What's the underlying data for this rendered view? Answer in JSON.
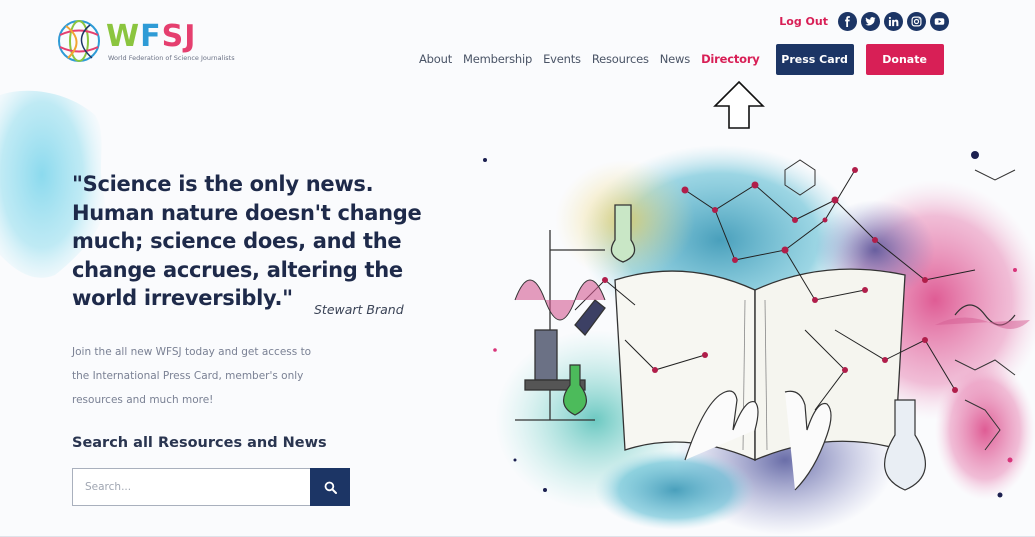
{
  "brand": {
    "letters": [
      "W",
      "F",
      "S",
      "J"
    ],
    "subtitle": "World Federation of Science Journalists",
    "colors": {
      "green": "#8bc53f",
      "blue": "#2e9bd6",
      "pink": "#e53f6f",
      "navy": "#1c3565",
      "accent": "#d81f56"
    }
  },
  "topbar": {
    "logout_label": "Log Out",
    "social_icons": [
      "facebook-icon",
      "twitter-icon",
      "linkedin-icon",
      "instagram-icon",
      "youtube-icon"
    ]
  },
  "nav": {
    "items": [
      {
        "label": "About"
      },
      {
        "label": "Membership"
      },
      {
        "label": "Events"
      },
      {
        "label": "Resources"
      },
      {
        "label": "News"
      },
      {
        "label": "Directory"
      }
    ],
    "active": "Directory",
    "press_card_label": "Press Card",
    "donate_label": "Donate"
  },
  "hero": {
    "quote_lines": [
      "\"Science is the only news.",
      "Human nature doesn't change",
      "much; science does, and the",
      "change accrues, altering the",
      "world irreversibly.\""
    ],
    "author": "Stewart Brand",
    "intro_lines": [
      "Join the all new WFSJ today and get access to",
      "the International Press Card, member's only",
      "resources and much more!"
    ]
  },
  "search": {
    "title": "Search all Resources and News",
    "placeholder": "Search...",
    "value": ""
  }
}
